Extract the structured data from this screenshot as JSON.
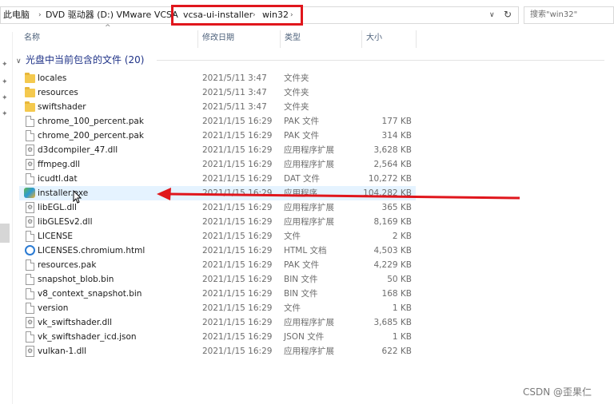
{
  "address_bar": {
    "crumbs": [
      "此电脑",
      "DVD 驱动器 (D:) VMware VCSA",
      "vcsa-ui-installer",
      "win32"
    ],
    "separator": "›",
    "dropdown_glyph": "∨",
    "refresh_glyph": "↻"
  },
  "search": {
    "placeholder": "搜索\"win32\""
  },
  "columns": {
    "name": "名称",
    "date": "修改日期",
    "type": "类型",
    "size": "大小"
  },
  "group": {
    "label": "光盘中当前包含的文件 (20)"
  },
  "files": [
    {
      "name": "locales",
      "date": "2021/5/11 3:47",
      "type": "文件夹",
      "size": "",
      "icon": "folder-icon"
    },
    {
      "name": "resources",
      "date": "2021/5/11 3:47",
      "type": "文件夹",
      "size": "",
      "icon": "folder-icon"
    },
    {
      "name": "swiftshader",
      "date": "2021/5/11 3:47",
      "type": "文件夹",
      "size": "",
      "icon": "folder-icon"
    },
    {
      "name": "chrome_100_percent.pak",
      "date": "2021/1/15 16:29",
      "type": "PAK 文件",
      "size": "177 KB",
      "icon": "file-icon"
    },
    {
      "name": "chrome_200_percent.pak",
      "date": "2021/1/15 16:29",
      "type": "PAK 文件",
      "size": "314 KB",
      "icon": "file-icon"
    },
    {
      "name": "d3dcompiler_47.dll",
      "date": "2021/1/15 16:29",
      "type": "应用程序扩展",
      "size": "3,628 KB",
      "icon": "dll-icon"
    },
    {
      "name": "ffmpeg.dll",
      "date": "2021/1/15 16:29",
      "type": "应用程序扩展",
      "size": "2,564 KB",
      "icon": "dll-icon"
    },
    {
      "name": "icudtl.dat",
      "date": "2021/1/15 16:29",
      "type": "DAT 文件",
      "size": "10,272 KB",
      "icon": "file-icon"
    },
    {
      "name": "installer.exe",
      "date": "2021/1/15 16:29",
      "type": "应用程序",
      "size": "104,282 KB",
      "icon": "exe-icon"
    },
    {
      "name": "libEGL.dll",
      "date": "2021/1/15 16:29",
      "type": "应用程序扩展",
      "size": "365 KB",
      "icon": "dll-icon"
    },
    {
      "name": "libGLESv2.dll",
      "date": "2021/1/15 16:29",
      "type": "应用程序扩展",
      "size": "8,169 KB",
      "icon": "dll-icon"
    },
    {
      "name": "LICENSE",
      "date": "2021/1/15 16:29",
      "type": "文件",
      "size": "2 KB",
      "icon": "file-icon"
    },
    {
      "name": "LICENSES.chromium.html",
      "date": "2021/1/15 16:29",
      "type": "HTML 文档",
      "size": "4,503 KB",
      "icon": "html-icon"
    },
    {
      "name": "resources.pak",
      "date": "2021/1/15 16:29",
      "type": "PAK 文件",
      "size": "4,229 KB",
      "icon": "file-icon"
    },
    {
      "name": "snapshot_blob.bin",
      "date": "2021/1/15 16:29",
      "type": "BIN 文件",
      "size": "50 KB",
      "icon": "file-icon"
    },
    {
      "name": "v8_context_snapshot.bin",
      "date": "2021/1/15 16:29",
      "type": "BIN 文件",
      "size": "168 KB",
      "icon": "file-icon"
    },
    {
      "name": "version",
      "date": "2021/1/15 16:29",
      "type": "文件",
      "size": "1 KB",
      "icon": "file-icon"
    },
    {
      "name": "vk_swiftshader.dll",
      "date": "2021/1/15 16:29",
      "type": "应用程序扩展",
      "size": "3,685 KB",
      "icon": "dll-icon"
    },
    {
      "name": "vk_swiftshader_icd.json",
      "date": "2021/1/15 16:29",
      "type": "JSON 文件",
      "size": "1 KB",
      "icon": "file-icon"
    },
    {
      "name": "vulkan-1.dll",
      "date": "2021/1/15 16:29",
      "type": "应用程序扩展",
      "size": "622 KB",
      "icon": "dll-icon"
    }
  ],
  "selected_file": "installer.exe",
  "watermark": "CSDN @歪果仁",
  "annotation_color": "#e0161c"
}
